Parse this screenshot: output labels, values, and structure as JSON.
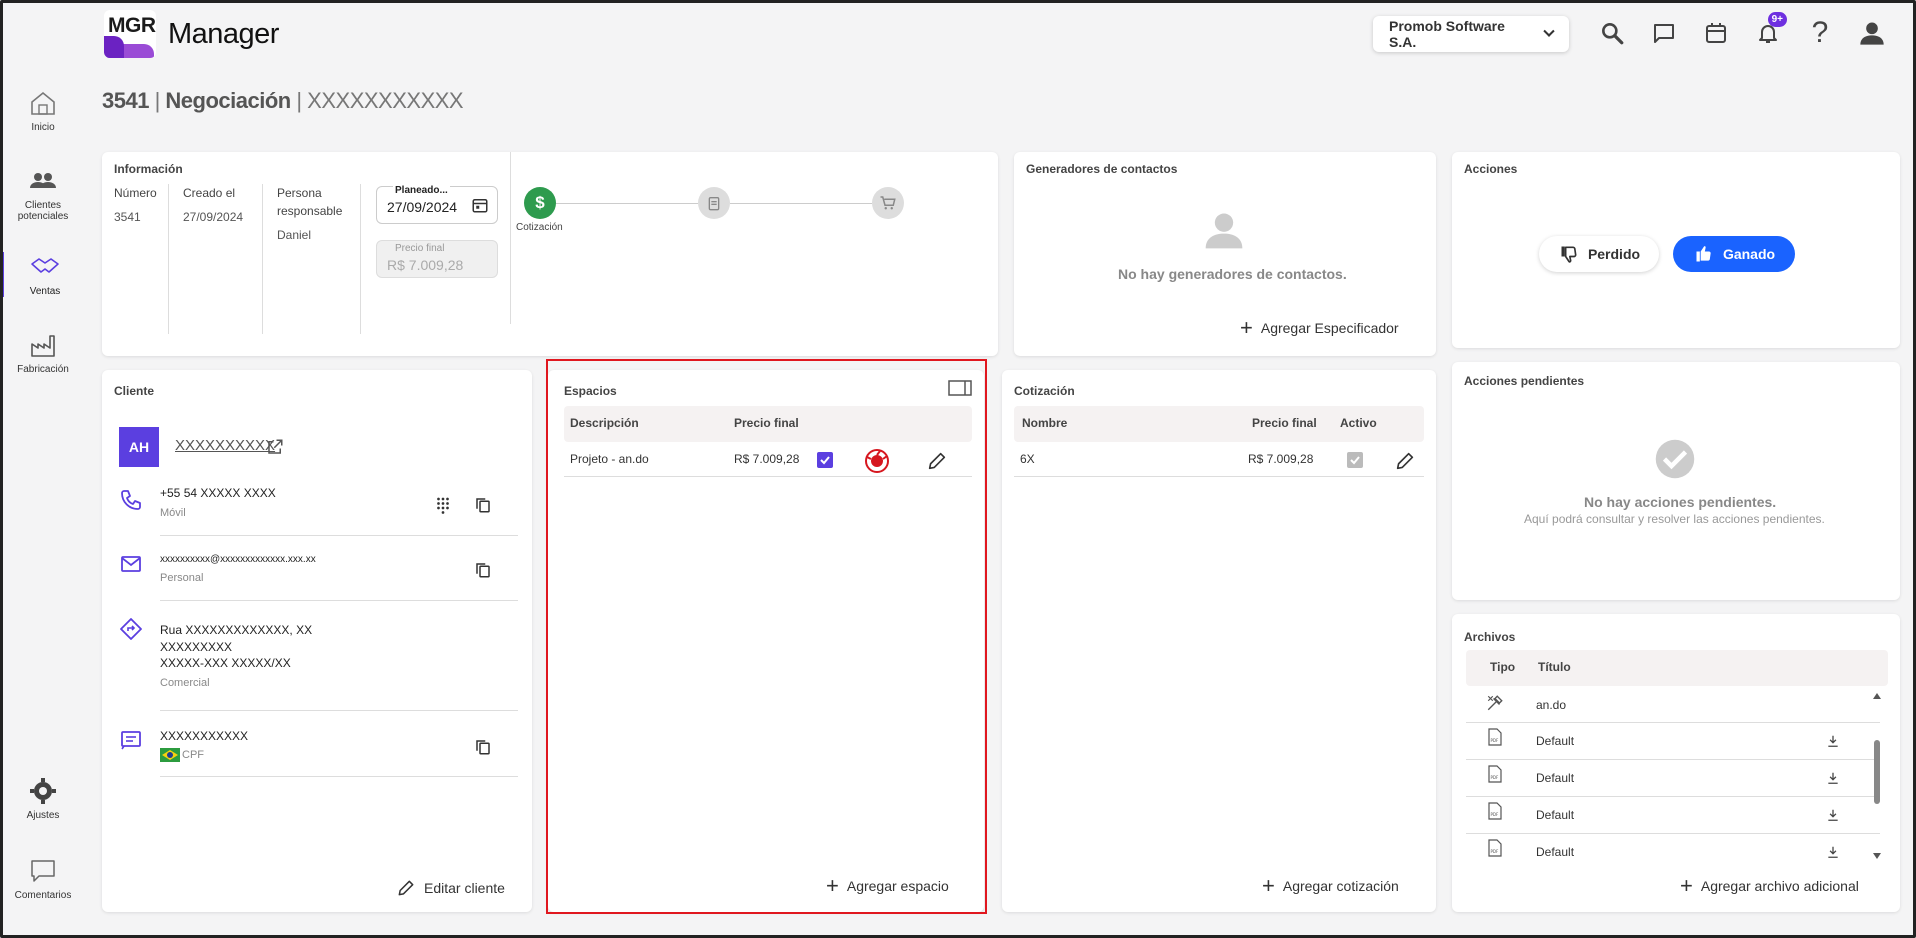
{
  "header": {
    "logo_text": "MGR",
    "app_title": "Manager",
    "company": "Promob Software S.A.",
    "notification_badge": "9+"
  },
  "sidebar": {
    "items": [
      {
        "label": "Inicio",
        "icon": "home-icon"
      },
      {
        "label": "Clientes potenciales",
        "icon": "people-icon"
      },
      {
        "label": "Ventas",
        "icon": "handshake-icon"
      },
      {
        "label": "Fabricación",
        "icon": "factory-icon"
      },
      {
        "label": "Ajustes",
        "icon": "gear-icon"
      },
      {
        "label": "Comentarios",
        "icon": "comment-icon"
      }
    ]
  },
  "page": {
    "title_num": "3541",
    "title_sep1": " | ",
    "title_stage": "Negociación",
    "title_sep2": " | ",
    "title_name": "XXXXXXXXXXX"
  },
  "info": {
    "title": "Información",
    "numero_label": "Número",
    "numero_value": "3541",
    "creado_label": "Creado el",
    "creado_value": "27/09/2024",
    "persona_label": "Persona responsable",
    "persona_value": "Daniel",
    "planeado_label": "Planeado...",
    "planeado_value": "27/09/2024",
    "precio_label": "Precio final",
    "precio_value": "R$ 7.009,28",
    "step1_label": "Cotización",
    "step1_color": "#2e9b4e"
  },
  "generadores": {
    "title": "Generadores de contactos",
    "empty": "No hay generadores de contactos.",
    "add": "Agregar Especificador"
  },
  "acciones": {
    "title": "Acciones",
    "lost": "Perdido",
    "won": "Ganado",
    "won_color": "#1a63ff"
  },
  "cliente": {
    "title": "Cliente",
    "initials": "AH",
    "name": "XXXXXXXXXX",
    "phone": "+55 54 XXXXX XXXX",
    "phone_type": "Móvil",
    "email": "xxxxxxxxxx@xxxxxxxxxxxxx.xxx.xx",
    "email_type": "Personal",
    "address_line1": "Rua XXXXXXXXXXXXX, XX",
    "address_line2": "XXXXXXXXX",
    "address_line3": "XXXXX-XXX XXXXX/XX",
    "address_type": "Comercial",
    "doc": "XXXXXXXXXXX",
    "doc_type": "CPF",
    "edit": "Editar cliente",
    "accent": "#5b3fe0"
  },
  "espacios": {
    "title": "Espacios",
    "col_desc": "Descripción",
    "col_price": "Precio final",
    "rows": [
      {
        "desc": "Projeto - an.do",
        "price": "R$ 7.009,28"
      }
    ],
    "add": "Agregar espacio"
  },
  "cotizacion": {
    "title": "Cotización",
    "col_name": "Nombre",
    "col_price": "Precio final",
    "col_active": "Activo",
    "rows": [
      {
        "name": "6X",
        "price": "R$ 7.009,28"
      }
    ],
    "add": "Agregar cotización"
  },
  "pendientes": {
    "title": "Acciones pendientes",
    "empty_title": "No hay acciones pendientes.",
    "empty_sub": "Aquí podrá consultar y resolver las acciones pendientes."
  },
  "archivos": {
    "title": "Archivos",
    "col_tipo": "Tipo",
    "col_titulo": "Título",
    "rows": [
      {
        "title": "an.do",
        "icon": "design-tools-icon"
      },
      {
        "title": "Default",
        "icon": "pdf-icon"
      },
      {
        "title": "Default",
        "icon": "pdf-icon"
      },
      {
        "title": "Default",
        "icon": "pdf-icon"
      },
      {
        "title": "Default",
        "icon": "pdf-icon"
      }
    ],
    "add": "Agregar archivo adicional"
  }
}
